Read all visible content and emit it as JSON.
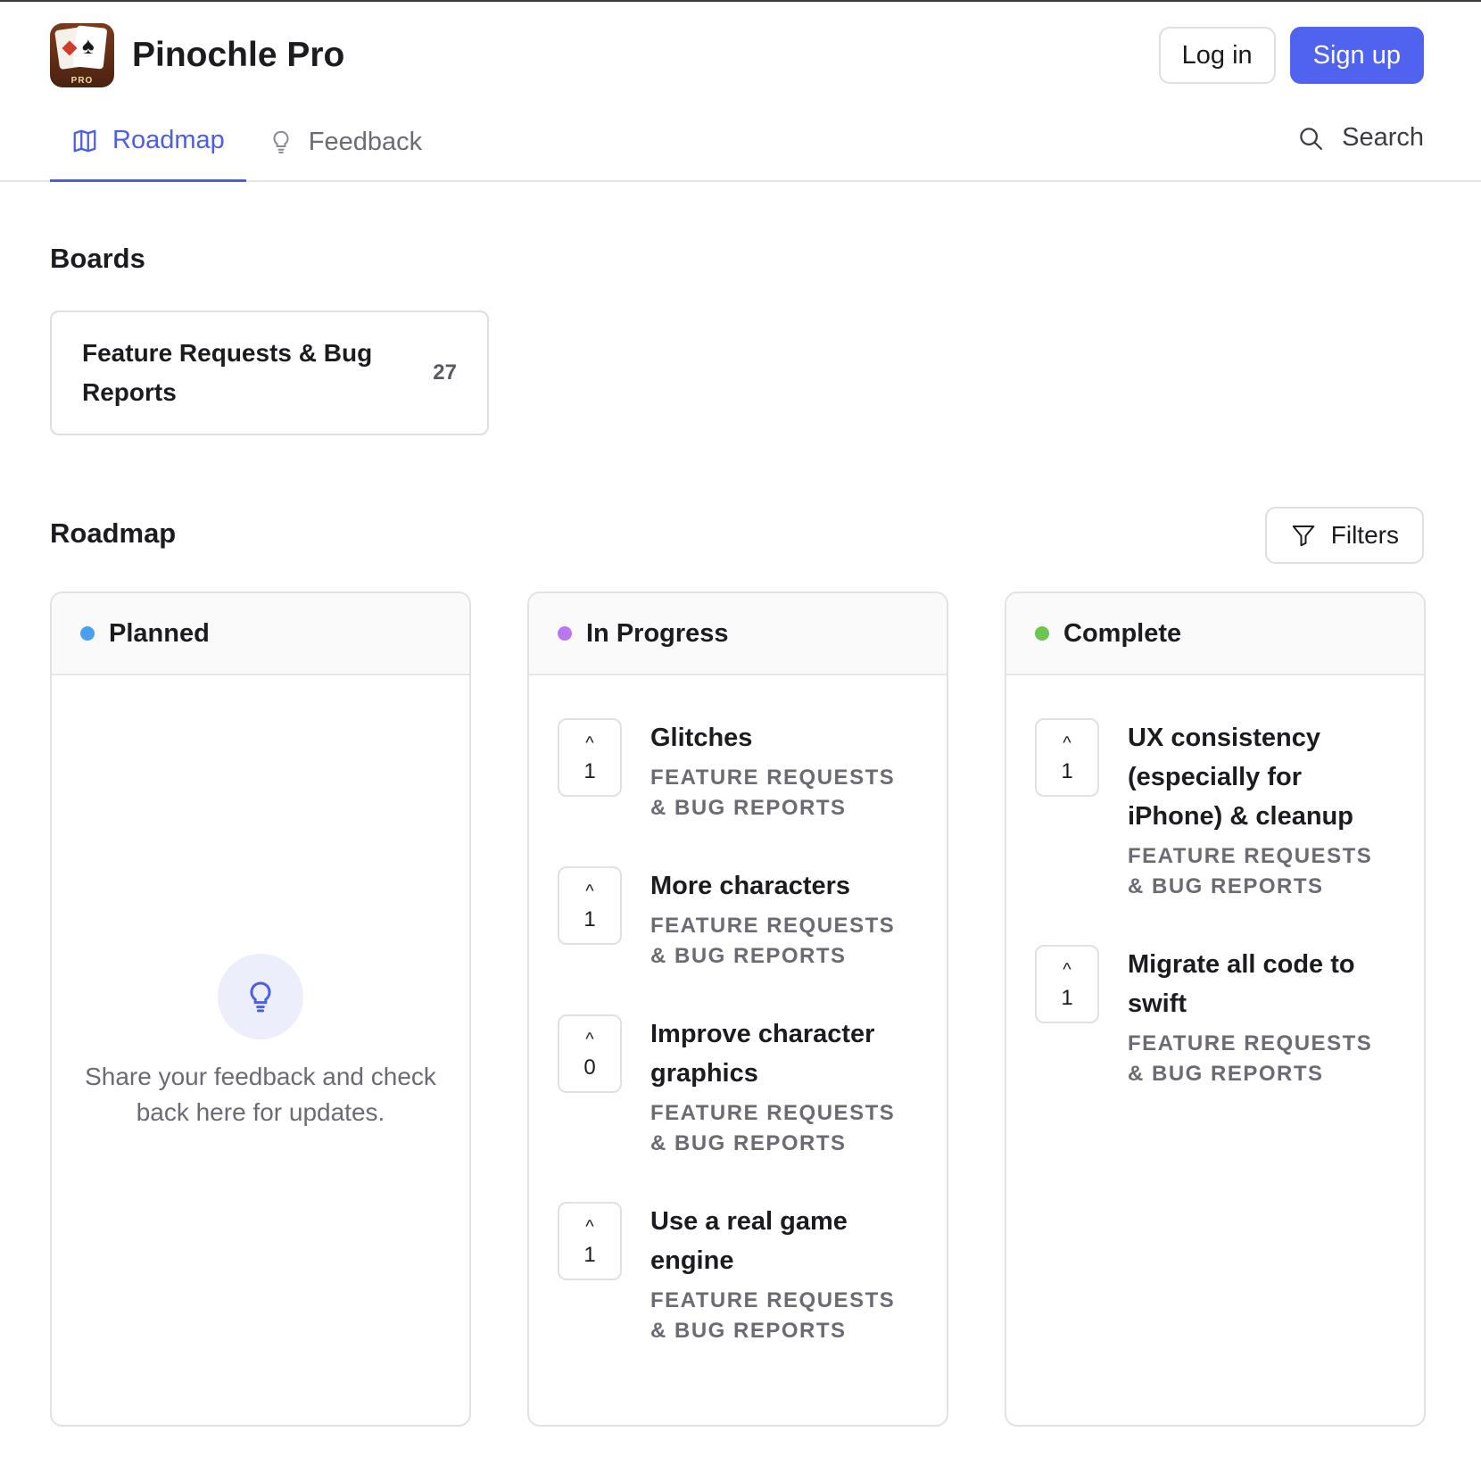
{
  "app": {
    "name": "Pinochle Pro",
    "logo_badge": "PRO"
  },
  "auth": {
    "login": "Log in",
    "signup": "Sign up"
  },
  "tabs": [
    {
      "label": "Roadmap",
      "icon": "map-icon",
      "active": true
    },
    {
      "label": "Feedback",
      "icon": "lightbulb-icon",
      "active": false
    }
  ],
  "search": {
    "label": "Search"
  },
  "boards": {
    "title": "Boards",
    "items": [
      {
        "name": "Feature Requests & Bug Reports",
        "count": "27"
      }
    ]
  },
  "roadmap": {
    "title": "Roadmap",
    "filters_label": "Filters",
    "columns": [
      {
        "name": "Planned",
        "color": "#4a9ff0",
        "empty_text": "Share your feedback and check back here for updates.",
        "items": []
      },
      {
        "name": "In Progress",
        "color": "#b877ef",
        "items": [
          {
            "title": "Glitches",
            "board": "FEATURE REQUESTS & BUG REPORTS",
            "votes": "1"
          },
          {
            "title": "More characters",
            "board": "FEATURE REQUESTS & BUG REPORTS",
            "votes": "1"
          },
          {
            "title": "Improve character graphics",
            "board": "FEATURE REQUESTS & BUG REPORTS",
            "votes": "0"
          },
          {
            "title": "Use a real game engine",
            "board": "FEATURE REQUESTS & BUG REPORTS",
            "votes": "1"
          }
        ]
      },
      {
        "name": "Complete",
        "color": "#6cc54e",
        "items": [
          {
            "title": "UX consistency (especially for iPhone) & cleanup",
            "board": "FEATURE REQUESTS & BUG REPORTS",
            "votes": "1"
          },
          {
            "title": "Migrate all code to swift",
            "board": "FEATURE REQUESTS & BUG REPORTS",
            "votes": "1"
          }
        ]
      }
    ]
  },
  "colors": {
    "accent": "#5063ef",
    "tab_active": "#4a5ee6"
  }
}
